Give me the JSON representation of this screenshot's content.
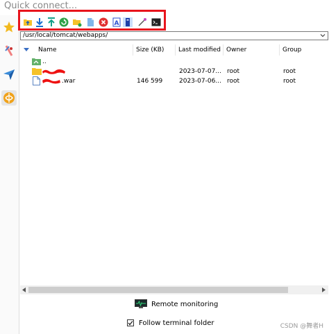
{
  "quick_connect": {
    "placeholder": "Quick connect..."
  },
  "sidebar": {
    "items": [
      {
        "icon": "star-icon",
        "active": false
      },
      {
        "icon": "sessions-icon",
        "active": false
      },
      {
        "icon": "send-icon",
        "active": false
      },
      {
        "icon": "sftp-browser-icon",
        "active": true
      }
    ]
  },
  "toolbar": {
    "buttons": [
      {
        "icon": "parent-folder-icon"
      },
      {
        "icon": "download-icon"
      },
      {
        "icon": "upload-icon"
      },
      {
        "icon": "refresh-icon"
      },
      {
        "icon": "new-folder-icon"
      },
      {
        "icon": "new-file-icon"
      },
      {
        "icon": "delete-icon"
      },
      {
        "icon": "open-with-icon"
      },
      {
        "icon": "properties-icon"
      },
      {
        "icon": "edit-icon"
      },
      {
        "icon": "terminal-icon"
      }
    ]
  },
  "path": {
    "value": "/usr/local/tomcat/webapps/"
  },
  "table": {
    "columns": {
      "name": "Name",
      "size": "Size (KB)",
      "modified": "Last modified",
      "owner": "Owner",
      "group": "Group"
    },
    "rows": [
      {
        "type": "parent",
        "name": "..",
        "size": "",
        "modified": "",
        "owner": "",
        "group": ""
      },
      {
        "type": "folder",
        "name": "",
        "size": "",
        "modified": "2023-07-07...",
        "owner": "root",
        "group": "root"
      },
      {
        "type": "file",
        "name": ".war",
        "size": "146 599",
        "modified": "2023-07-06...",
        "owner": "root",
        "group": "root"
      }
    ]
  },
  "footer": {
    "remote_monitoring": "Remote monitoring",
    "follow_terminal": "Follow terminal folder",
    "follow_checked": true
  },
  "watermark": "CSDN @舞者H",
  "colors": {
    "highlight_box": "#e8141c",
    "redaction": "#ee1111"
  }
}
